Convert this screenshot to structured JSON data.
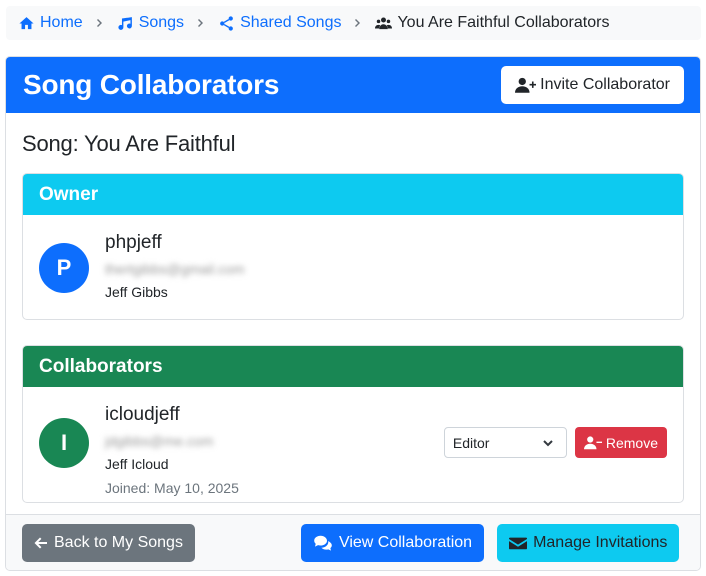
{
  "breadcrumb": {
    "home": "Home",
    "songs": "Songs",
    "shared": "Shared Songs",
    "current": "You Are Faithful Collaborators"
  },
  "header": {
    "title": "Song Collaborators",
    "invite_label": "Invite Collaborator"
  },
  "song": {
    "heading": "Song: You Are Faithful"
  },
  "owner": {
    "section_title": "Owner",
    "initial": "P",
    "username": "phpjeff",
    "email": "thertgibbs@gmail.com",
    "full_name": "Jeff Gibbs"
  },
  "collaborators": {
    "section_title": "Collaborators",
    "items": [
      {
        "initial": "I",
        "username": "icloudjeff",
        "email": "jdgibbs@me.com",
        "full_name": "Jeff Icloud",
        "joined": "Joined: May 10, 2025",
        "role": "Editor",
        "remove_label": "Remove"
      }
    ]
  },
  "footer": {
    "back_label": "Back to My Songs",
    "view_label": "View Collaboration",
    "manage_label": "Manage Invitations"
  },
  "colors": {
    "primary": "#0d6efd",
    "info": "#0dcaf0",
    "success": "#198754",
    "danger": "#dc3545",
    "secondary": "#6c757d"
  },
  "icons": {
    "home": "home-icon",
    "songs": "music-note-icon",
    "shared": "share-icon",
    "current": "users-icon",
    "invite": "user-plus-icon",
    "remove": "user-minus-icon",
    "back": "arrow-left-icon",
    "view": "comments-icon",
    "manage": "envelope-icon"
  }
}
